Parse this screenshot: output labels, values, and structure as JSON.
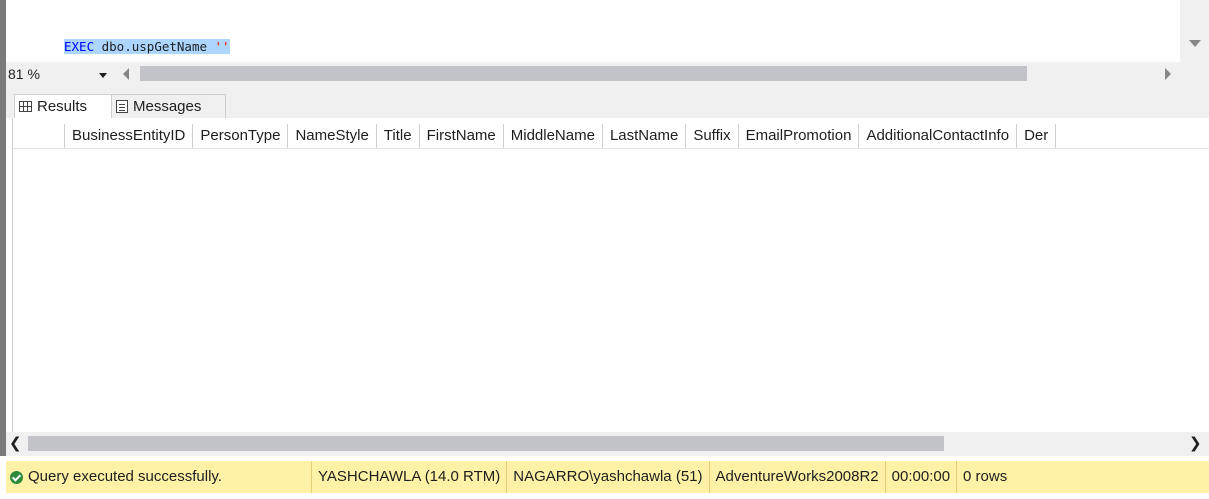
{
  "editor": {
    "code_keyword": "EXEC",
    "code_proc": " dbo.uspGetName ",
    "code_string": "''"
  },
  "zoom": {
    "value": "81 %"
  },
  "tabs": [
    {
      "label": "Results",
      "icon": "grid-icon",
      "active": true
    },
    {
      "label": "Messages",
      "icon": "messages-icon",
      "active": false
    }
  ],
  "grid": {
    "columns": [
      "BusinessEntityID",
      "PersonType",
      "NameStyle",
      "Title",
      "FirstName",
      "MiddleName",
      "LastName",
      "Suffix",
      "EmailPromotion",
      "AdditionalContactInfo",
      "Der"
    ],
    "rows": []
  },
  "status": {
    "message": "Query executed successfully.",
    "server": "YASHCHAWLA (14.0 RTM)",
    "user": "NAGARRO\\yashchawla (51)",
    "database": "AdventureWorks2008R2",
    "elapsed": "00:00:00",
    "rows": "0 rows",
    "colors": {
      "status_bg": "#fff2a6",
      "ok_icon": "#2e8b3c"
    }
  },
  "colors": {
    "keyword": "#0000ff",
    "string": "#ff0000",
    "selection": "#add6ff"
  }
}
